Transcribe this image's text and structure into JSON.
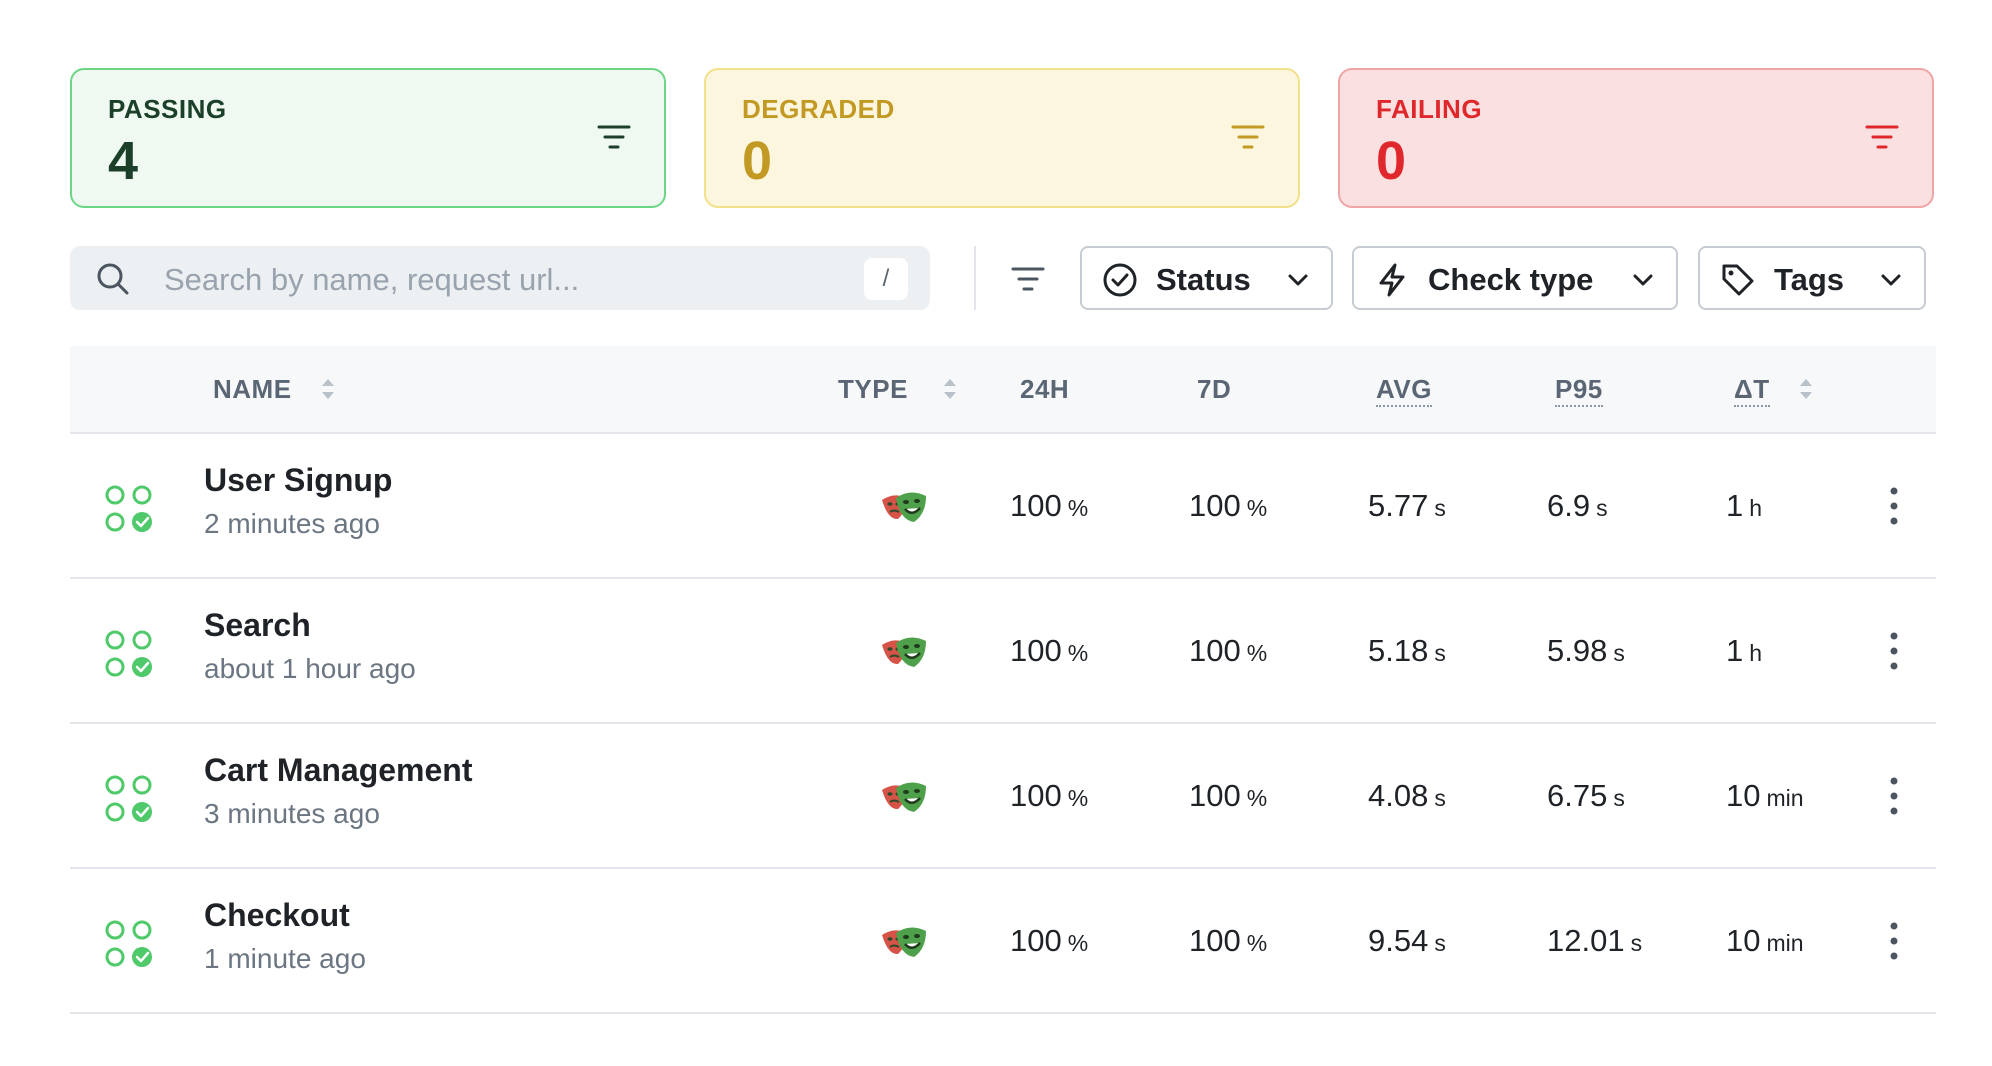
{
  "summary": {
    "passing": {
      "label": "PASSING",
      "count": "4",
      "color": "#1b3f29"
    },
    "degraded": {
      "label": "DEGRADED",
      "count": "0",
      "color": "#c29a23"
    },
    "failing": {
      "label": "FAILING",
      "count": "0",
      "color": "#e0272c"
    }
  },
  "toolbar": {
    "search_placeholder": "Search by name, request url...",
    "search_shortcut": "/",
    "filters": {
      "status": "Status",
      "check_type": "Check type",
      "tags": "Tags"
    }
  },
  "table": {
    "headers": {
      "name": "NAME",
      "type": "TYPE",
      "h24": "24H",
      "d7": "7D",
      "avg": "AVG",
      "p95": "P95",
      "dt": "ΔT"
    },
    "rows": [
      {
        "name": "User Signup",
        "last_run": "2 minutes ago",
        "type_icon": "playwright-icon",
        "h24": "100",
        "h24_unit": "%",
        "d7": "100",
        "d7_unit": "%",
        "avg": "5.77",
        "avg_unit": "s",
        "p95": "6.9",
        "p95_unit": "s",
        "dt": "1",
        "dt_unit": "h"
      },
      {
        "name": "Search",
        "last_run": "about 1 hour ago",
        "type_icon": "playwright-icon",
        "h24": "100",
        "h24_unit": "%",
        "d7": "100",
        "d7_unit": "%",
        "avg": "5.18",
        "avg_unit": "s",
        "p95": "5.98",
        "p95_unit": "s",
        "dt": "1",
        "dt_unit": "h"
      },
      {
        "name": "Cart Management",
        "last_run": "3 minutes ago",
        "type_icon": "playwright-icon",
        "h24": "100",
        "h24_unit": "%",
        "d7": "100",
        "d7_unit": "%",
        "avg": "4.08",
        "avg_unit": "s",
        "p95": "6.75",
        "p95_unit": "s",
        "dt": "10",
        "dt_unit": "min"
      },
      {
        "name": "Checkout",
        "last_run": "1 minute ago",
        "type_icon": "playwright-icon",
        "h24": "100",
        "h24_unit": "%",
        "d7": "100",
        "d7_unit": "%",
        "avg": "9.54",
        "avg_unit": "s",
        "p95": "12.01",
        "p95_unit": "s",
        "dt": "10",
        "dt_unit": "min"
      }
    ]
  },
  "colors": {
    "pass": "#4fc96a",
    "degraded": "#c29a23",
    "fail": "#e0272c"
  }
}
